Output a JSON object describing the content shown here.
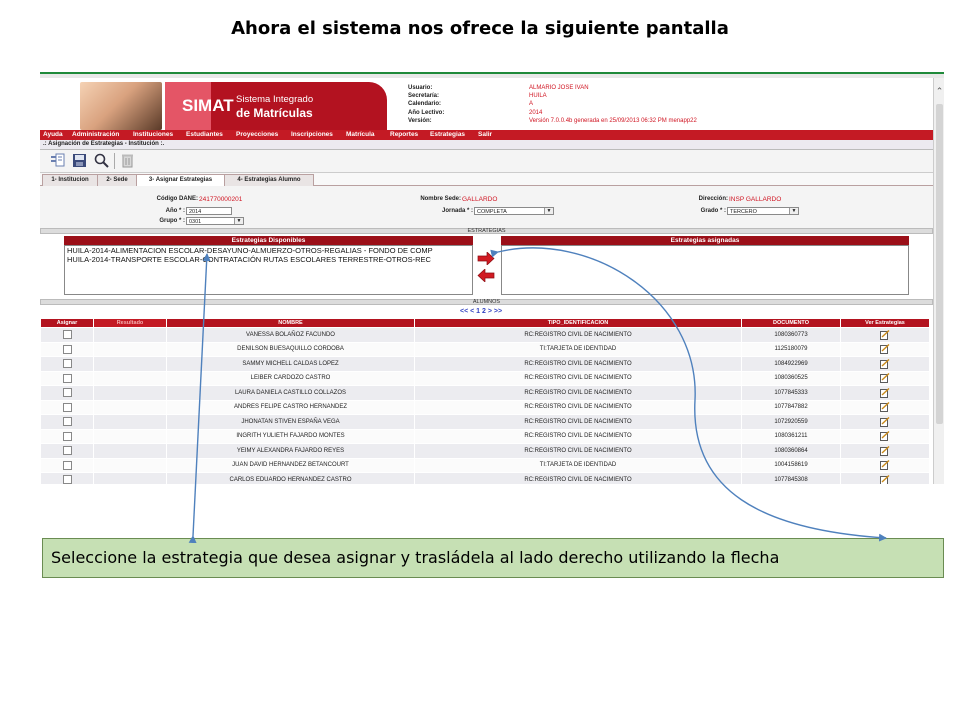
{
  "slide": {
    "title": "Ahora el sistema nos ofrece la siguiente pantalla",
    "callout": "Seleccione la estrategia que desea asignar y trasládela al lado derecho utilizando la flecha"
  },
  "app": {
    "logo": {
      "name": "SIMAT",
      "subtitle_line1": "Sistema Integrado",
      "subtitle_line2": "de Matrículas"
    },
    "user_info": {
      "labels": [
        "Usuario:",
        "Secretaría:",
        "Calendario:",
        "Año Lectivo:",
        "Versión:"
      ],
      "values": [
        "ALMARIO JOSE IVAN",
        "HUILA",
        "A",
        "2014",
        "Versión 7.0.0.4b generada en 25/09/2013 06:32 PM menapp22"
      ]
    },
    "menu": [
      "Ayuda",
      "Administración",
      "Instituciones",
      "Estudiantes",
      "Proyecciones",
      "Inscripciones",
      "Matrícula",
      "Reportes",
      "Estrategias",
      "Salir"
    ],
    "page_heading": ".: Asignación de Estrategias - Institución :.",
    "toolbar": [
      "new-icon",
      "save-icon",
      "search-icon",
      "delete-icon"
    ],
    "tabs": [
      "1- Institucion",
      "2- Sede",
      "3- Asignar Estrategias",
      "4- Estrategias Alumno"
    ],
    "active_tab": 2,
    "form": {
      "codigo_dane_label": "Código DANE:",
      "codigo_dane_value": "241770000201",
      "nombre_sede_label": "Nombre Sede:",
      "nombre_sede_value": "GALLARDO",
      "direccion_label": "Dirección:",
      "direccion_value": "INSP GALLARDO",
      "anio_label": "Año * :",
      "anio_value": "2014",
      "jornada_label": "Jornada * :",
      "jornada_value": "COMPLETA",
      "grado_label": "Grado * :",
      "grado_value": "TERCERO",
      "grupo_label": "Grupo * :",
      "grupo_value": "0301"
    },
    "strategies": {
      "section_label": "ESTRATEGIAS",
      "available_header": "Estrategias Disponibles",
      "assigned_header": "Estrategias asignadas",
      "available": [
        "HUILA-2014-ALIMENTACION ESCOLAR-DESAYUNO-ALMUERZO-OTROS-REGALIAS - FONDO DE COMP",
        "HUILA-2014-TRANSPORTE ESCOLAR-CONTRATACIÓN RUTAS ESCOLARES TERRESTRE-OTROS-REC"
      ],
      "assigned": []
    },
    "students": {
      "section_label": "ALUMNOS",
      "pager": "<< < 1 2 > >>",
      "columns": [
        "Asignar",
        "Resultado",
        "NOMBRE",
        "TIPO_IDENTIFICACION",
        "DOCUMENTO",
        "Ver Estrategias"
      ],
      "rows": [
        {
          "nombre": "VANESSA BOLAÑOZ FACUNDO",
          "tipo": "RC:REGISTRO CIVIL DE NACIMIENTO",
          "documento": "1080360773"
        },
        {
          "nombre": "DENILSON BUESAQUILLO CORDOBA",
          "tipo": "TI:TARJETA DE IDENTIDAD",
          "documento": "1125180079"
        },
        {
          "nombre": "SAMMY MICHELL CALDAS LOPEZ",
          "tipo": "RC:REGISTRO CIVIL DE NACIMIENTO",
          "documento": "1084922969"
        },
        {
          "nombre": "LEIBER CARDOZO CASTRO",
          "tipo": "RC:REGISTRO CIVIL DE NACIMIENTO",
          "documento": "1080360525"
        },
        {
          "nombre": "LAURA DANIELA CASTILLO COLLAZOS",
          "tipo": "RC:REGISTRO CIVIL DE NACIMIENTO",
          "documento": "1077845333"
        },
        {
          "nombre": "ANDRES FELIPE CASTRO HERNANDEZ",
          "tipo": "RC:REGISTRO CIVIL DE NACIMIENTO",
          "documento": "1077847882"
        },
        {
          "nombre": "JHONATAN STIVEN ESPAÑA VEGA",
          "tipo": "RC:REGISTRO CIVIL DE NACIMIENTO",
          "documento": "1072920559"
        },
        {
          "nombre": "INGRITH YULIETH FAJARDO MONTES",
          "tipo": "RC:REGISTRO CIVIL DE NACIMIENTO",
          "documento": "1080361211"
        },
        {
          "nombre": "YEIMY ALEXANDRA FAJARDO REYES",
          "tipo": "RC:REGISTRO CIVIL DE NACIMIENTO",
          "documento": "1080360864"
        },
        {
          "nombre": "JUAN DAVID HERNANDEZ BETANCOURT",
          "tipo": "TI:TARJETA DE IDENTIDAD",
          "documento": "1004158619"
        },
        {
          "nombre": "CARLOS EDUARDO HERNANDEZ CASTRO",
          "tipo": "RC:REGISTRO CIVIL DE NACIMIENTO",
          "documento": "1077845308"
        }
      ]
    }
  },
  "colors": {
    "brand_red": "#c41a24",
    "header_dark_red": "#9b0f18",
    "callout_green": "#c6e0b4",
    "annotation_blue": "#4f81bd"
  }
}
